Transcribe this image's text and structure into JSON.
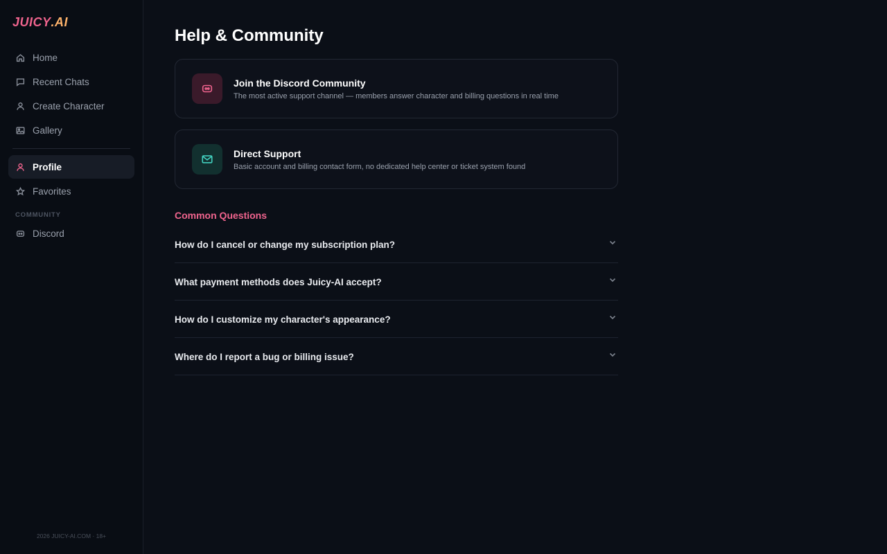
{
  "brand": {
    "part1": "JUICY",
    "part2": ".AI",
    "accent": "#f0648e",
    "accent2": "#ffb36b"
  },
  "sidebar": {
    "items": [
      {
        "label": "Home",
        "icon": "home-icon"
      },
      {
        "label": "Recent Chats",
        "icon": "chat-icon"
      },
      {
        "label": "Create Character",
        "icon": "user-icon"
      },
      {
        "label": "Gallery",
        "icon": "image-icon"
      }
    ],
    "items2": [
      {
        "label": "Profile",
        "icon": "user-icon",
        "active": true
      },
      {
        "label": "Favorites",
        "icon": "star-icon"
      }
    ],
    "section_label": "COMMUNITY",
    "community_items": [
      {
        "label": "Discord",
        "icon": "discord-icon"
      }
    ],
    "footer": "2026 JUICY-AI.COM · 18+"
  },
  "main": {
    "title": "Help & Community",
    "cards": [
      {
        "title": "Join the Discord Community",
        "desc": "The most active support channel — members answer character and billing questions in real time",
        "icon": "discord-icon",
        "color": "#f0648e"
      },
      {
        "title": "Direct Support",
        "desc": "Basic account and billing contact form, no dedicated help center or ticket system found",
        "icon": "mail-icon",
        "color": "#43d1c0"
      }
    ],
    "faq_heading": "Common Questions",
    "faq": [
      {
        "q": "How do I cancel or change my subscription plan?"
      },
      {
        "q": "What payment methods does Juicy-AI accept?"
      },
      {
        "q": "How do I customize my character's appearance?"
      },
      {
        "q": "Where do I report a bug or billing issue?"
      }
    ]
  }
}
